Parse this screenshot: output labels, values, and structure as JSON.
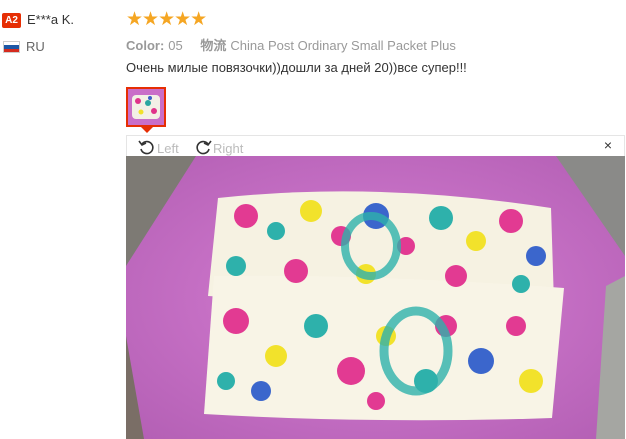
{
  "reviewer": {
    "badge": "A2",
    "name": "E***a K.",
    "country": "RU",
    "flag_colors": [
      "#ffffff",
      "#1c57a5",
      "#d52b1e"
    ]
  },
  "review": {
    "stars": "★★★★★",
    "rating": 5,
    "color_label": "Color:",
    "color_value": "05",
    "shipping_label": "物流",
    "shipping_value": "China Post Ordinary Small Packet Plus",
    "text": "Очень милые повязочки))дошли за дней 20))все супер!!!"
  },
  "viewer": {
    "left_label": "Left",
    "right_label": "Right",
    "close_label": "×"
  },
  "colors": {
    "accent": "#e62e04",
    "star": "#f5a623",
    "background_fabric": "#c96ec8"
  }
}
